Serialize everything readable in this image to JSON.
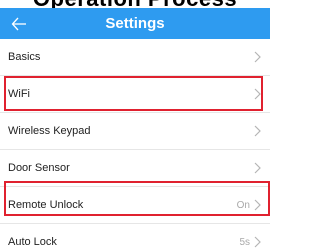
{
  "page_title_strip": "Operation Process",
  "header": {
    "title": "Settings",
    "back_icon": "arrow-left-icon",
    "background": "#2e9bf0"
  },
  "settings": {
    "items": [
      {
        "label": "Basics",
        "value": ""
      },
      {
        "label": "WiFi",
        "value": ""
      },
      {
        "label": "Wireless Keypad",
        "value": ""
      },
      {
        "label": "Door Sensor",
        "value": ""
      },
      {
        "label": "Remote Unlock",
        "value": "On"
      },
      {
        "label": "Auto Lock",
        "value": "5s"
      }
    ]
  },
  "highlight_color": "#e0212f"
}
